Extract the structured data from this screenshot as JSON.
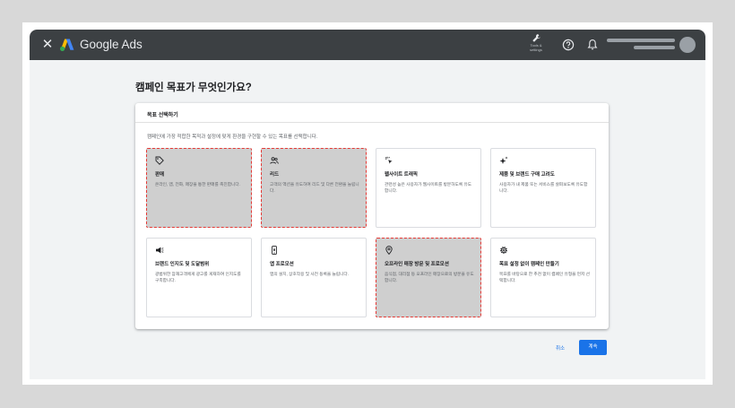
{
  "app": {
    "title": "Google Ads",
    "tools_label": "Tools &\nsettings",
    "colors": {
      "topbar": "#3c4043",
      "accent": "#1a73e8",
      "selected_border": "#e53935"
    }
  },
  "page": {
    "heading": "캠페인 목표가 무엇인가요?"
  },
  "card": {
    "title": "목표 선택하기",
    "description": "캠페인에 가장 적합한 목적과 설정에 맞게 환경을 구현할 수 있는 목표를 선택합니다.",
    "options": [
      {
        "icon": "tag-icon",
        "name": "판매",
        "desc": "온라인, 앱, 전화, 매장을 통한 판매를 촉진합니다.",
        "selected": true
      },
      {
        "icon": "people-icon",
        "name": "리드",
        "desc": "고객의 액션을 유도하여 리드 및 다른 전환을 늘립니다.",
        "selected": true
      },
      {
        "icon": "cursor-click-icon",
        "name": "웹사이트 트래픽",
        "desc": "관련성 높은 사용자가 웹사이트를 방문하도록 유도합니다.",
        "selected": false
      },
      {
        "icon": "sparkle-icon",
        "name": "제품 및 브랜드 구매 고려도",
        "desc": "사용자가 내 제품 또는 서비스를 살펴보도록 유도합니다.",
        "selected": false
      },
      {
        "icon": "megaphone-icon",
        "name": "브랜드 인지도 및 도달범위",
        "desc": "광범위한 잠재고객에게 광고를 게재하여 인지도를 구축합니다.",
        "selected": false
      },
      {
        "icon": "phone-icon",
        "name": "앱 프로모션",
        "desc": "앱의 설치, 상호작용 및 사전 등록을 늘립니다.",
        "selected": false
      },
      {
        "icon": "location-pin-icon",
        "name": "오프라인 매장 방문 및 프로모션",
        "desc": "음식점, 대리점 등 오프라인 매장으로의 방문을 유도합니다.",
        "selected": true
      },
      {
        "icon": "gear-icon",
        "name": "목표 설정 없이 캠페인 만들기",
        "desc": "목표를 바탕으로 한 추천 없이 캠페인 유형을 먼저 선택합니다.",
        "selected": false
      }
    ]
  },
  "actions": {
    "cancel": "취소",
    "continue": "계속"
  }
}
